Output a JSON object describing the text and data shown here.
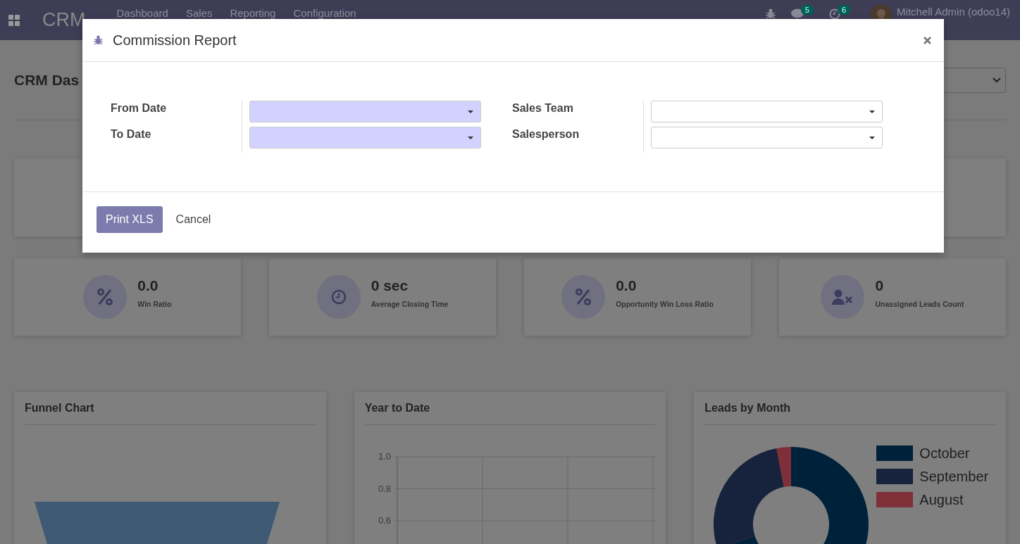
{
  "navbar": {
    "app_name": "CRM",
    "menu": [
      "Dashboard",
      "Sales",
      "Reporting",
      "Configuration"
    ],
    "messages_badge": "5",
    "activities_badge": "6",
    "user": "Mitchell Admin (odoo14)"
  },
  "dashboard": {
    "title": "CRM Das",
    "stats": [
      {
        "value": "0.0",
        "label": "Win Ratio",
        "kind": "percent"
      },
      {
        "value": "0 sec",
        "label": "Average Closing Time",
        "kind": "clock"
      },
      {
        "value": "0.0",
        "label": "Opportunity Win Loss Ratio",
        "kind": "percent"
      },
      {
        "value": "0",
        "label": "Unassigned Leads Count",
        "kind": "user"
      }
    ],
    "panels": [
      {
        "title": "Funnel Chart",
        "kind": "funnel"
      },
      {
        "title": "Year to Date",
        "kind": "line",
        "y_axis_labels": [
          "1.0",
          "0.8",
          "0.6"
        ]
      },
      {
        "title": "Leads by Month",
        "kind": "donut",
        "legend": [
          {
            "label": "October",
            "color": "#00213a"
          },
          {
            "label": "September",
            "color": "#17223d"
          },
          {
            "label": "August",
            "color": "#7f2f38"
          }
        ]
      }
    ]
  },
  "dialog": {
    "title": "Commission Report",
    "field_groups": [
      [
        {
          "label": "From Date",
          "required": true
        },
        {
          "label": "To Date",
          "required": true
        }
      ],
      [
        {
          "label": "Sales Team",
          "required": false
        },
        {
          "label": "Salesperson",
          "required": false
        }
      ]
    ],
    "buttons": [
      {
        "label": "Print XLS",
        "kind": "primary"
      },
      {
        "label": "Cancel",
        "kind": "link"
      }
    ]
  }
}
